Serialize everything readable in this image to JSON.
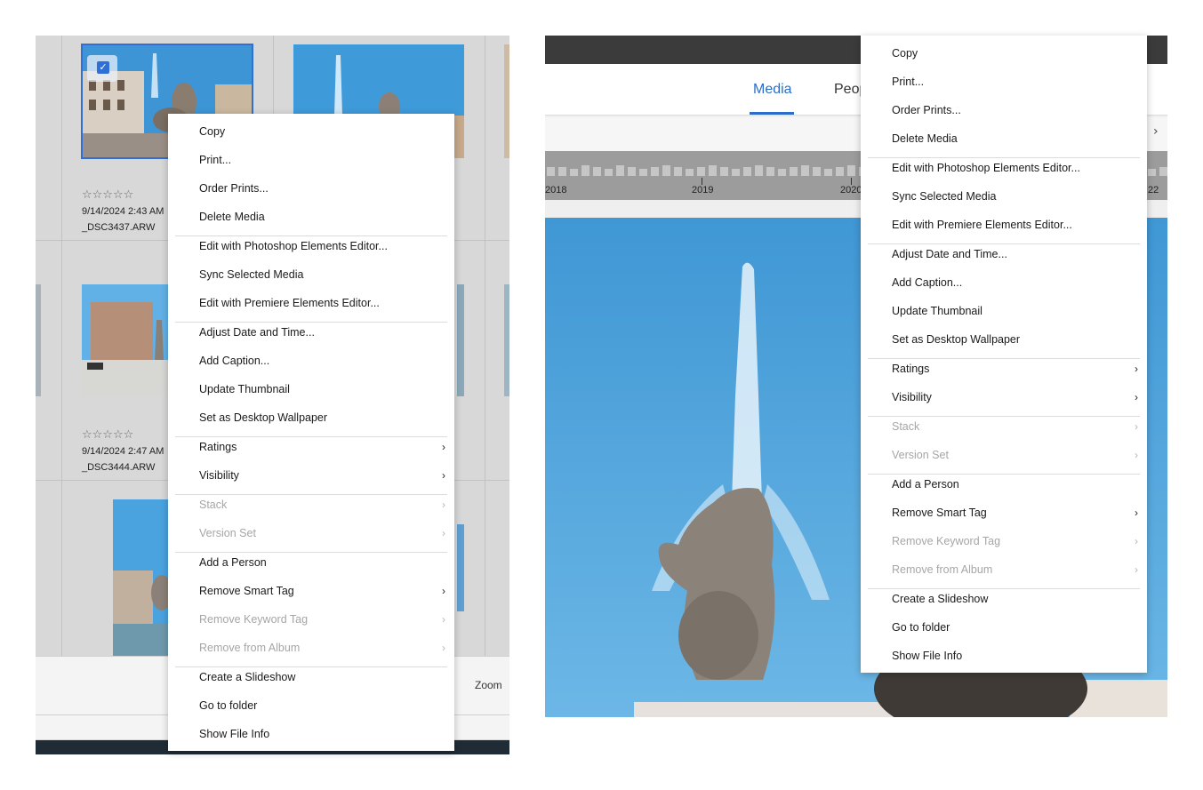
{
  "left": {
    "thumbnails": [
      {
        "date": "9/14/2024 2:43 AM",
        "filename": "_DSC3437.ARW",
        "stars": "☆☆☆☆☆",
        "selected": true
      },
      {
        "date": "9/14/2024 2:47 AM",
        "filename": "_DSC3444.ARW",
        "stars": "☆☆☆☆☆",
        "selected": false
      }
    ],
    "zoom_label": "Zoom",
    "checkmark": "✓"
  },
  "right": {
    "tabs": [
      {
        "label": "Media",
        "active": true
      },
      {
        "label": "Peop",
        "active": false
      }
    ],
    "timeline_years": [
      "2018",
      "2019",
      "2020",
      "22"
    ],
    "chevron": "›"
  },
  "menu": {
    "items": [
      {
        "label": "Copy",
        "enabled": true,
        "submenu": false
      },
      {
        "label": "Print...",
        "enabled": true,
        "submenu": false
      },
      {
        "label": "Order Prints...",
        "enabled": true,
        "submenu": false
      },
      {
        "label": "Delete Media",
        "enabled": true,
        "submenu": false,
        "sep_after": true
      },
      {
        "label": "Edit with Photoshop Elements Editor...",
        "enabled": true,
        "submenu": false
      },
      {
        "label": "Sync Selected Media",
        "enabled": true,
        "submenu": false
      },
      {
        "label": "Edit with Premiere Elements Editor...",
        "enabled": true,
        "submenu": false,
        "sep_after": true
      },
      {
        "label": "Adjust Date and Time...",
        "enabled": true,
        "submenu": false
      },
      {
        "label": "Add Caption...",
        "enabled": true,
        "submenu": false
      },
      {
        "label": "Update Thumbnail",
        "enabled": true,
        "submenu": false
      },
      {
        "label": "Set as Desktop Wallpaper",
        "enabled": true,
        "submenu": false,
        "sep_after": true
      },
      {
        "label": "Ratings",
        "enabled": true,
        "submenu": true
      },
      {
        "label": "Visibility",
        "enabled": true,
        "submenu": true,
        "sep_after": true
      },
      {
        "label": "Stack",
        "enabled": false,
        "submenu": true
      },
      {
        "label": "Version Set",
        "enabled": false,
        "submenu": true,
        "sep_after": true
      },
      {
        "label": "Add a Person",
        "enabled": true,
        "submenu": false
      },
      {
        "label": "Remove Smart Tag",
        "enabled": true,
        "submenu": true
      },
      {
        "label": "Remove Keyword Tag",
        "enabled": false,
        "submenu": true
      },
      {
        "label": "Remove from Album",
        "enabled": false,
        "submenu": true,
        "sep_after": true
      },
      {
        "label": "Create a Slideshow",
        "enabled": true,
        "submenu": false
      },
      {
        "label": "Go to folder",
        "enabled": true,
        "submenu": false
      },
      {
        "label": "Show File Info",
        "enabled": true,
        "submenu": false
      }
    ],
    "arrow_glyph": "›"
  },
  "colors": {
    "accent": "#2a6ec9",
    "disabled_text": "#a6a6a6",
    "sky": "#4a9fd8"
  }
}
